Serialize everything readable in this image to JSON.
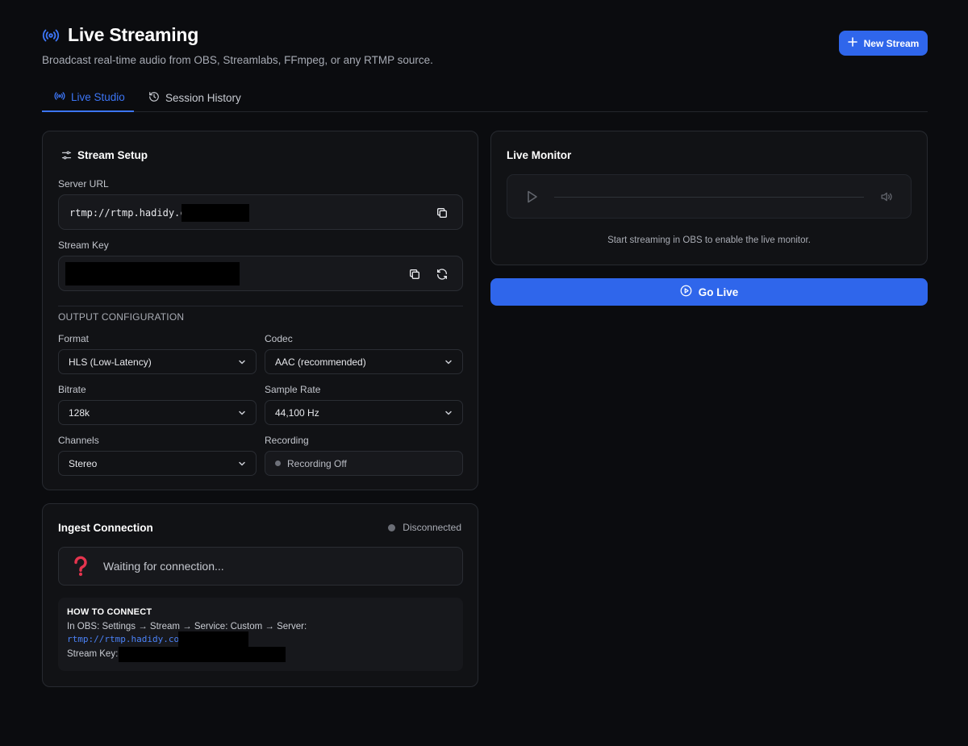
{
  "header": {
    "title": "Live Streaming",
    "subtitle": "Broadcast real-time audio from OBS, Streamlabs, FFmpeg, or any RTMP source.",
    "new_stream_label": "New Stream"
  },
  "tabs": [
    {
      "label": "Live Studio",
      "icon": "broadcast-icon",
      "active": true
    },
    {
      "label": "Session History",
      "icon": "history-icon",
      "active": false
    }
  ],
  "setup": {
    "title": "Stream Setup",
    "server_url_label": "Server URL",
    "server_url_value": "rtmp://rtmp.hadidy.com",
    "stream_key_label": "Stream Key",
    "output_config_caption": "OUTPUT CONFIGURATION",
    "format_label": "Format",
    "format_value": "HLS (Low-Latency)",
    "codec_label": "Codec",
    "codec_value": "AAC (recommended)",
    "bitrate_label": "Bitrate",
    "bitrate_value": "128k",
    "sample_rate_label": "Sample Rate",
    "sample_rate_value": "44,100 Hz",
    "channels_label": "Channels",
    "channels_value": "Stereo",
    "recording_label": "Recording",
    "recording_value": "Recording Off"
  },
  "ingest": {
    "title": "Ingest Connection",
    "status": "Disconnected",
    "waiting_text": "Waiting for connection...",
    "howto_title": "HOW TO CONNECT",
    "howto_line": "In OBS: Settings → Stream → Service: Custom → Server:",
    "howto_url": "rtmp://rtmp.hadidy.com",
    "stream_key_label": "Stream Key:"
  },
  "monitor": {
    "title": "Live Monitor",
    "hint": "Start streaming in OBS to enable the live monitor."
  },
  "go_live_label": "Go Live",
  "colors": {
    "accent": "#2f66eb",
    "background": "#0b0c0f",
    "card": "#111215",
    "status_idle": "#6b6e76"
  }
}
